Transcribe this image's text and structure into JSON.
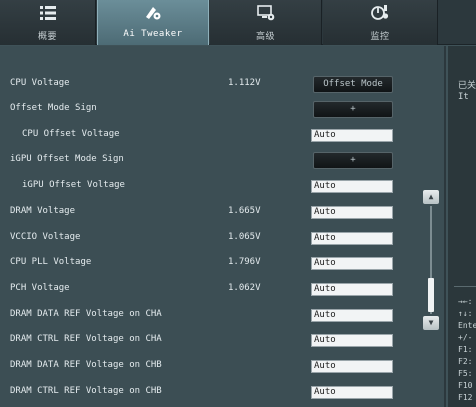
{
  "tabs": [
    {
      "label": "概要",
      "icon": "list-icon",
      "active": false
    },
    {
      "label": "Ai Tweaker",
      "icon": "tweaker-icon",
      "active": true
    },
    {
      "label": "高级",
      "icon": "advanced-icon",
      "active": false
    },
    {
      "label": "监控",
      "icon": "monitor-icon",
      "active": false
    }
  ],
  "settings": [
    {
      "label": "CPU Voltage",
      "value": "1.112V",
      "control": "button",
      "control_text": "Offset Mode"
    },
    {
      "label": "Offset Mode Sign",
      "value": "",
      "control": "button",
      "control_text": "+"
    },
    {
      "label": "CPU Offset Voltage",
      "value": "",
      "control": "input",
      "control_text": "Auto"
    },
    {
      "label": "iGPU Offset Mode Sign",
      "value": "",
      "control": "button",
      "control_text": "+"
    },
    {
      "label": "iGPU Offset Voltage",
      "value": "",
      "control": "input",
      "control_text": "Auto"
    },
    {
      "label": "DRAM Voltage",
      "value": "1.665V",
      "control": "input",
      "control_text": "Auto"
    },
    {
      "label": "VCCIO Voltage",
      "value": "1.065V",
      "control": "input",
      "control_text": "Auto"
    },
    {
      "label": "CPU PLL Voltage",
      "value": "1.796V",
      "control": "input",
      "control_text": "Auto"
    },
    {
      "label": "PCH Voltage",
      "value": "1.062V",
      "control": "input",
      "control_text": "Auto"
    },
    {
      "label": "DRAM DATA REF Voltage on CHA",
      "value": "",
      "control": "input",
      "control_text": "Auto"
    },
    {
      "label": "DRAM CTRL REF Voltage on CHA",
      "value": "",
      "control": "input",
      "control_text": "Auto"
    },
    {
      "label": "DRAM DATA REF Voltage on CHB",
      "value": "",
      "control": "input",
      "control_text": "Auto"
    },
    {
      "label": "DRAM CTRL REF Voltage on CHB",
      "value": "",
      "control": "input",
      "control_text": "Auto"
    }
  ],
  "help": {
    "line1": "已关",
    "line2": "It",
    "keys": [
      "→←:",
      "↑↓:",
      "Ente",
      "+/-",
      "F1:",
      "F2:",
      "F5:",
      "F10",
      "F12"
    ]
  },
  "scrollbar": {
    "up": "▲",
    "down": "▼"
  }
}
